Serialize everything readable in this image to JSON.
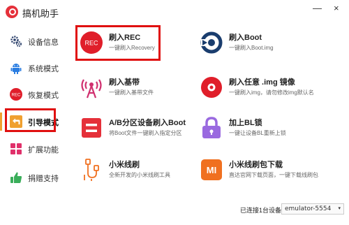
{
  "app": {
    "title": "搞机助手",
    "minimize": "—",
    "close": "×"
  },
  "sidebar": {
    "items": [
      {
        "label": "设备信息",
        "icon": "gear-icon"
      },
      {
        "label": "系统模式",
        "icon": "android-icon"
      },
      {
        "label": "恢复模式",
        "icon": "rec-icon"
      },
      {
        "label": "引导模式",
        "icon": "back-arrow-icon",
        "active": true
      },
      {
        "label": "扩展功能",
        "icon": "grid-icon"
      },
      {
        "label": "捐赠支持",
        "icon": "thumbs-up-icon"
      }
    ]
  },
  "cards": [
    {
      "title": "刷入REC",
      "desc": "一键刷入Recovery",
      "icon": "rec-icon",
      "icon_text": "REC"
    },
    {
      "title": "刷入Boot",
      "desc": "一键刷入Boot.img",
      "icon": "boot-icon"
    },
    {
      "title": "刷入基带",
      "desc": "一键刷入基带文件",
      "icon": "antenna-icon"
    },
    {
      "title": "刷入任意 .img 镜像",
      "desc": "一键刷入img，请勿修改img默认名",
      "icon": "disc-icon"
    },
    {
      "title": "A/B分区设备刷入Boot",
      "desc": "将Boot文件一键刷入指定分区",
      "icon": "ab-partition-icon"
    },
    {
      "title": "加上BL锁",
      "desc": "一键让设备BL重新上锁",
      "icon": "lock-icon"
    },
    {
      "title": "小米线刷",
      "desc": "全新开发的小米线刷工具",
      "icon": "usb-cable-icon"
    },
    {
      "title": "小米线刷包下载",
      "desc": "直达官网下载页面，一键下载线刷包",
      "icon": "mi-logo-icon",
      "icon_text": "MI"
    }
  ],
  "status": {
    "connected": "已连接1台设备",
    "device": "emulator-5554",
    "caret": "▾"
  },
  "colors": {
    "accent_red": "#e5303a",
    "highlight_box": "#e01010",
    "active_bar": "#f0a030",
    "boot_blue": "#1a3d6e",
    "antenna_pink": "#d0306f",
    "lock_purple": "#9a6ae0",
    "mi_orange": "#f07020",
    "thumb_green": "#3aae5a"
  }
}
